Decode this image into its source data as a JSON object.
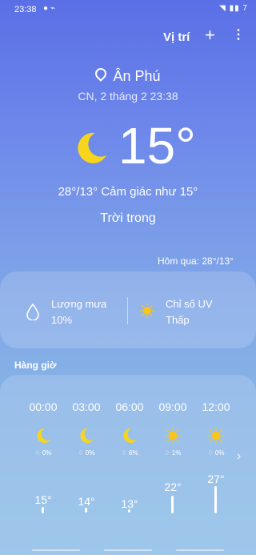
{
  "status": {
    "time": "23:38",
    "icons_left": "● ⌁",
    "icons_right": "◥ ▮▮ 7"
  },
  "header": {
    "location_button": "Vị trí",
    "add_icon": "plus-icon",
    "more_icon": "more-vert-icon"
  },
  "current": {
    "place": "Ân Phú",
    "datetime": "CN, 2 tháng 2 23:38",
    "temperature": "15°",
    "hi_lo_feels": "28°/13° Cảm giác như 15°",
    "condition": "Trời trong",
    "yesterday": "Hôm qua: 28°/13°",
    "icon": "moon-icon"
  },
  "details": {
    "rain_label": "Lượng mưa",
    "rain_value": "10%",
    "uv_label": "Chỉ số UV",
    "uv_value": "Thấp"
  },
  "hourly": {
    "title": "Hàng giờ",
    "items": [
      {
        "time": "00:00",
        "icon": "moon-icon",
        "precip": "0%",
        "temp": "15°"
      },
      {
        "time": "03:00",
        "icon": "moon-icon",
        "precip": "0%",
        "temp": "14°"
      },
      {
        "time": "06:00",
        "icon": "moon-icon",
        "precip": "6%",
        "temp": "13°"
      },
      {
        "time": "09:00",
        "icon": "sun-icon",
        "precip": "1%",
        "temp": "22°"
      },
      {
        "time": "12:00",
        "icon": "sun-icon",
        "precip": "0%",
        "temp": "27°"
      }
    ]
  },
  "colors": {
    "moon": "#f7d51d",
    "sun": "#f7c51d"
  }
}
